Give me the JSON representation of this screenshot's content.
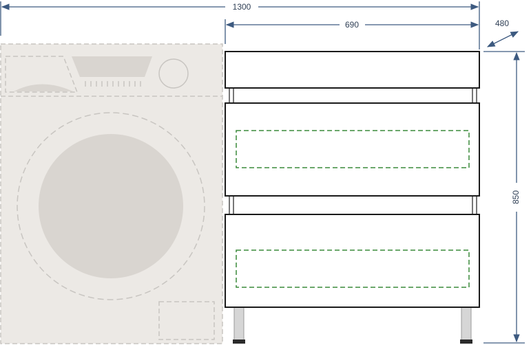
{
  "dimensions": {
    "total_width": "1300",
    "cabinet_width": "690",
    "depth": "480",
    "height": "850"
  },
  "colors": {
    "dimension_line": "#3d5a80",
    "washing_machine_fill": "#ece9e5",
    "washing_machine_outline": "#c8c5c1",
    "drum": "#d9d5d0",
    "cabinet_outline": "#1a1a1a",
    "drawer_inset": "#3a8a3a",
    "leg": "#d6d6d6"
  }
}
